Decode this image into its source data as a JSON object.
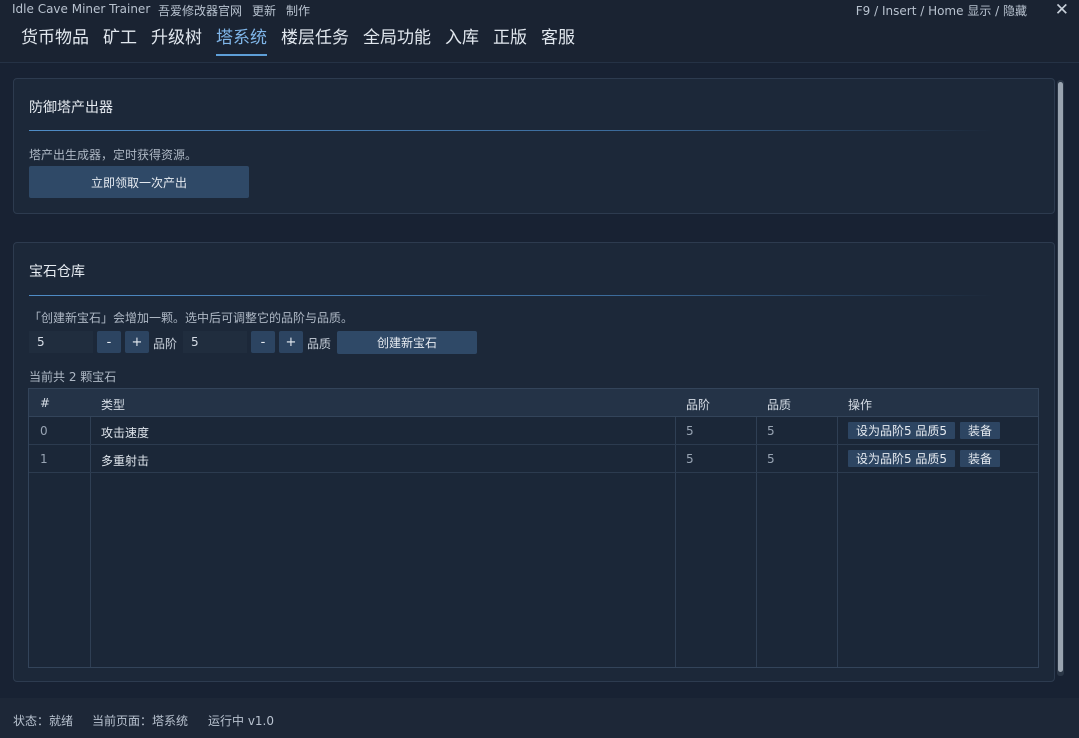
{
  "window": {
    "title": "Idle Cave Miner Trainer",
    "links": [
      "吾爱修改器官网",
      "更新",
      "制作"
    ],
    "hotkey_hint": "F9 / Insert / Home  显示 / 隐藏",
    "close_glyph": "✕"
  },
  "nav": {
    "tabs": [
      {
        "label": "货币物品"
      },
      {
        "label": "矿工"
      },
      {
        "label": "升级树"
      },
      {
        "label": "塔系统"
      },
      {
        "label": "楼层任务"
      },
      {
        "label": "全局功能"
      },
      {
        "label": "入库"
      },
      {
        "label": "正版"
      },
      {
        "label": "客服"
      }
    ],
    "active_index": 3
  },
  "tower_producer": {
    "title": "防御塔产出器",
    "description": "塔产出生成器，定时获得资源。",
    "button_label": "立即领取一次产出"
  },
  "gem_storage": {
    "title": "宝石仓库",
    "description": "「创建新宝石」会增加一颗。选中后可调整它的品阶与品质。",
    "tier_value": "5",
    "tier_label": "品阶",
    "quality_value": "5",
    "quality_label": "品质",
    "minus_label": "-",
    "plus_label": "+",
    "create_button_label": "创建新宝石",
    "count_text": "当前共 2 颗宝石",
    "table": {
      "headers": [
        "#",
        "类型",
        "品阶",
        "品质",
        "操作"
      ],
      "rows": [
        {
          "index": "0",
          "type": "攻击速度",
          "tier": "5",
          "quality": "5",
          "set_label": "设为品阶5 品质5",
          "equip_label": "装备"
        },
        {
          "index": "1",
          "type": "多重射击",
          "tier": "5",
          "quality": "5",
          "set_label": "设为品阶5 品质5",
          "equip_label": "装备"
        }
      ]
    }
  },
  "status_bar": {
    "status": "状态：就绪",
    "current_page": "当前页面：塔系统",
    "running": "运行中  v1.0"
  },
  "colors": {
    "background": "#1a2332",
    "accent": "#5e9fd8",
    "button": "#2f4967"
  }
}
